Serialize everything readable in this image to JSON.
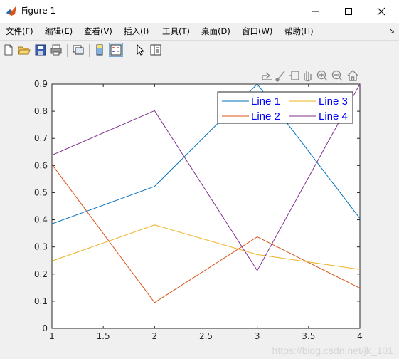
{
  "window": {
    "title": "Figure 1"
  },
  "menu": {
    "items": [
      "文件(F)",
      "编辑(E)",
      "查看(V)",
      "插入(I)",
      "工具(T)",
      "桌面(D)",
      "窗口(W)",
      "帮助(H)"
    ]
  },
  "watermark": "https://blog.csdn.net/jk_101",
  "colors": {
    "line1": "#0072bd",
    "line2": "#d95319",
    "line3": "#edb120",
    "line4": "#7e2f8e",
    "legend_text": "#0000ff"
  },
  "chart_data": {
    "type": "line",
    "x": [
      1,
      2,
      3,
      4
    ],
    "xlim": [
      1,
      4
    ],
    "ylim": [
      0,
      0.9
    ],
    "xticks": [
      "1",
      "1.5",
      "2",
      "2.5",
      "3",
      "3.5",
      "4"
    ],
    "yticks": [
      "0",
      "0.1",
      "0.2",
      "0.3",
      "0.4",
      "0.5",
      "0.6",
      "0.7",
      "0.8",
      "0.9"
    ],
    "legend_position": "top-right",
    "grid": false,
    "series": [
      {
        "name": "Line 1",
        "values": [
          0.385,
          0.523,
          0.9,
          0.405
        ]
      },
      {
        "name": "Line 2",
        "values": [
          0.604,
          0.095,
          0.337,
          0.148
        ]
      },
      {
        "name": "Line 3",
        "values": [
          0.248,
          0.381,
          0.272,
          0.217
        ]
      },
      {
        "name": "Line 4",
        "values": [
          0.638,
          0.802,
          0.213,
          0.9
        ]
      }
    ]
  }
}
